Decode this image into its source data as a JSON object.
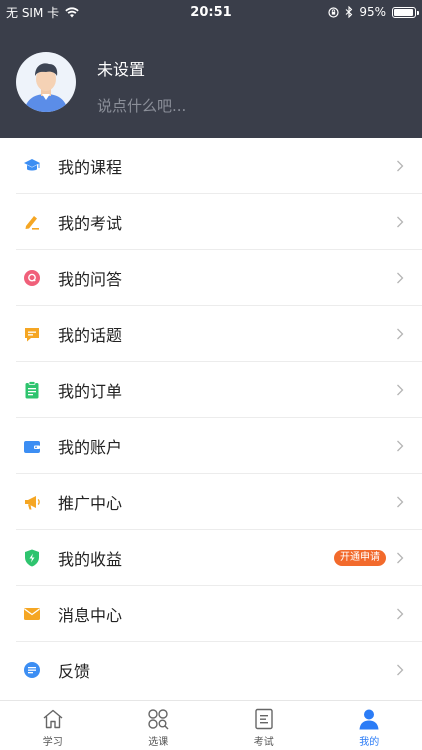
{
  "status_bar": {
    "carrier": "无 SIM 卡",
    "time": "20:51",
    "battery_text": "95%",
    "battery_level": 0.95
  },
  "profile": {
    "name": "未设置",
    "signature": "说点什么吧..."
  },
  "menu": {
    "items": [
      {
        "label": "我的课程",
        "icon": "graduation-cap-icon",
        "color": "#3c8ef3"
      },
      {
        "label": "我的考试",
        "icon": "pencil-icon",
        "color": "#f5a623"
      },
      {
        "label": "我的问答",
        "icon": "question-bubble-icon",
        "color": "#f0607a"
      },
      {
        "label": "我的话题",
        "icon": "chat-bubble-icon",
        "color": "#f5a623"
      },
      {
        "label": "我的订单",
        "icon": "clipboard-icon",
        "color": "#2ec46e"
      },
      {
        "label": "我的账户",
        "icon": "wallet-icon",
        "color": "#3c8ef3"
      },
      {
        "label": "推广中心",
        "icon": "megaphone-icon",
        "color": "#f5a623"
      },
      {
        "label": "我的收益",
        "icon": "shield-icon",
        "color": "#2ec46e",
        "badge": "开通申请"
      },
      {
        "label": "消息中心",
        "icon": "envelope-icon",
        "color": "#f5a623"
      },
      {
        "label": "反馈",
        "icon": "feedback-icon",
        "color": "#3c8ef3"
      }
    ]
  },
  "tabs": [
    {
      "label": "学习",
      "icon": "home-icon"
    },
    {
      "label": "选课",
      "icon": "course-select-icon"
    },
    {
      "label": "考试",
      "icon": "exam-doc-icon"
    },
    {
      "label": "我的",
      "icon": "person-icon",
      "active": true
    }
  ],
  "colors": {
    "header_bg": "#3a3e4a",
    "accent": "#2b7cf6",
    "badge": "#f26a2c"
  }
}
